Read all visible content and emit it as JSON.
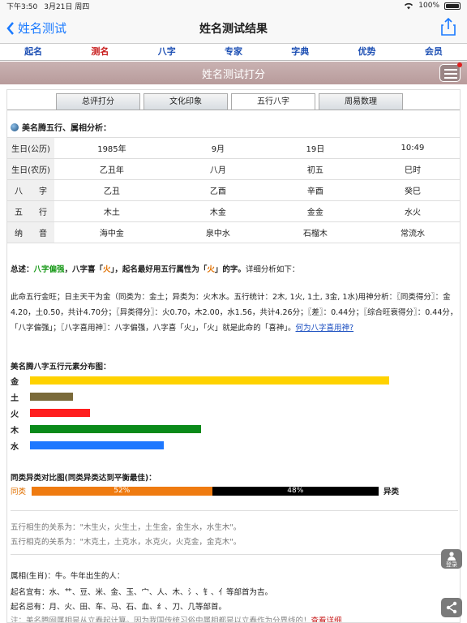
{
  "status": {
    "time": "下午3:50",
    "date": "3月21日 周四",
    "battery": "100%"
  },
  "nav": {
    "back_label": "姓名测试",
    "title": "姓名测试结果"
  },
  "menu": [
    {
      "label": "起名",
      "active": false
    },
    {
      "label": "测名",
      "active": true
    },
    {
      "label": "八字",
      "active": false
    },
    {
      "label": "专家",
      "active": false
    },
    {
      "label": "字典",
      "active": false
    },
    {
      "label": "优势",
      "active": false
    },
    {
      "label": "会员",
      "active": false
    }
  ],
  "banner": {
    "title": "姓名测试打分"
  },
  "tabs": [
    {
      "label": "总评打分",
      "active": false
    },
    {
      "label": "文化印象",
      "active": false
    },
    {
      "label": "五行八字",
      "active": true
    },
    {
      "label": "周易数理",
      "active": false
    }
  ],
  "section_title": "美名腾五行、属相分析：",
  "bazi_table": [
    {
      "head": "生日(公历)",
      "cells": [
        "1985年",
        "9月",
        "19日",
        "10:49"
      ]
    },
    {
      "head": "生日(农历)",
      "cells": [
        "乙丑年",
        "八月",
        "初五",
        "巳时"
      ]
    },
    {
      "head": "八　　字",
      "cells": [
        "乙丑",
        "乙酉",
        "辛酉",
        "癸巳"
      ]
    },
    {
      "head": "五　　行",
      "cells": [
        "木土",
        "木金",
        "金金",
        "水火"
      ]
    },
    {
      "head": "纳　　音",
      "cells": [
        "海中金",
        "泉中水",
        "石榴木",
        "常流水"
      ]
    }
  ],
  "summary": {
    "prefix": "总述：",
    "strength": "八字偏强",
    "mid1": "，八字喜「",
    "xi": "火",
    "mid2": "」，起名最好用五行属性为「",
    "xi2": "火",
    "mid3": "」的字。",
    "tail": "详细分析如下："
  },
  "detail": {
    "text": "此命五行金旺；日主天干为金（同类为：金土；异类为：火木水。五行统计：2木, 1火, 1土, 3金, 1水)用神分析：〖同类得分〗：金4.20，土0.50，共计4.70分；〖异类得分〗：火0.70，木2.00，水1.56，共计4.26分；〖差〗：0.44分；〖综合旺衰得分〗：0.44分，「八字偏强」；〖八字喜用神〗：八字偏强，八字喜「火」，「火」就是此命的「喜神」。",
    "link": "何为八字喜用神?"
  },
  "wuxing_title": "美名腾八字五行元素分布图：",
  "wuxing": [
    {
      "label": "金",
      "value": 4.2,
      "color": "#ffd200"
    },
    {
      "label": "土",
      "value": 0.5,
      "color": "#7a6a3a"
    },
    {
      "label": "火",
      "value": 0.7,
      "color": "#ff1e1e"
    },
    {
      "label": "木",
      "value": 2.0,
      "color": "#0a8a1a"
    },
    {
      "label": "水",
      "value": 1.56,
      "color": "#1e78ff"
    }
  ],
  "compare": {
    "title": "同类异类对比图(同类异类达到平衡最佳)：",
    "left_label": "同类",
    "left_pct": 52,
    "left_text": "52%",
    "right_pct": 48,
    "right_text": "48%",
    "right_label": "异类"
  },
  "relations": {
    "sheng": "五行相生的关系为：\"木生火，火生土，土生金，金生水，水生木\"。",
    "ke": "五行相克的关系为：\"木克土，土克水，水克火，火克金，金克木\"。"
  },
  "shuxiang": {
    "line1": "属相(生肖)：牛。牛年出生的人：",
    "line2": "起名宜有：水、艹、豆、米、金、玉、宀、人、木、氵、钅、亻等部首为吉。",
    "line3": "起名忌有：月、火、田、车、马、石、血、纟、刀、几等部首。"
  },
  "note": {
    "text": "注：美名腾网属相是从立春起计算。因为我国传统习俗中属相都是以立春作为分界线的！",
    "link": "查看详细"
  },
  "fab": {
    "login_label": "登录"
  }
}
